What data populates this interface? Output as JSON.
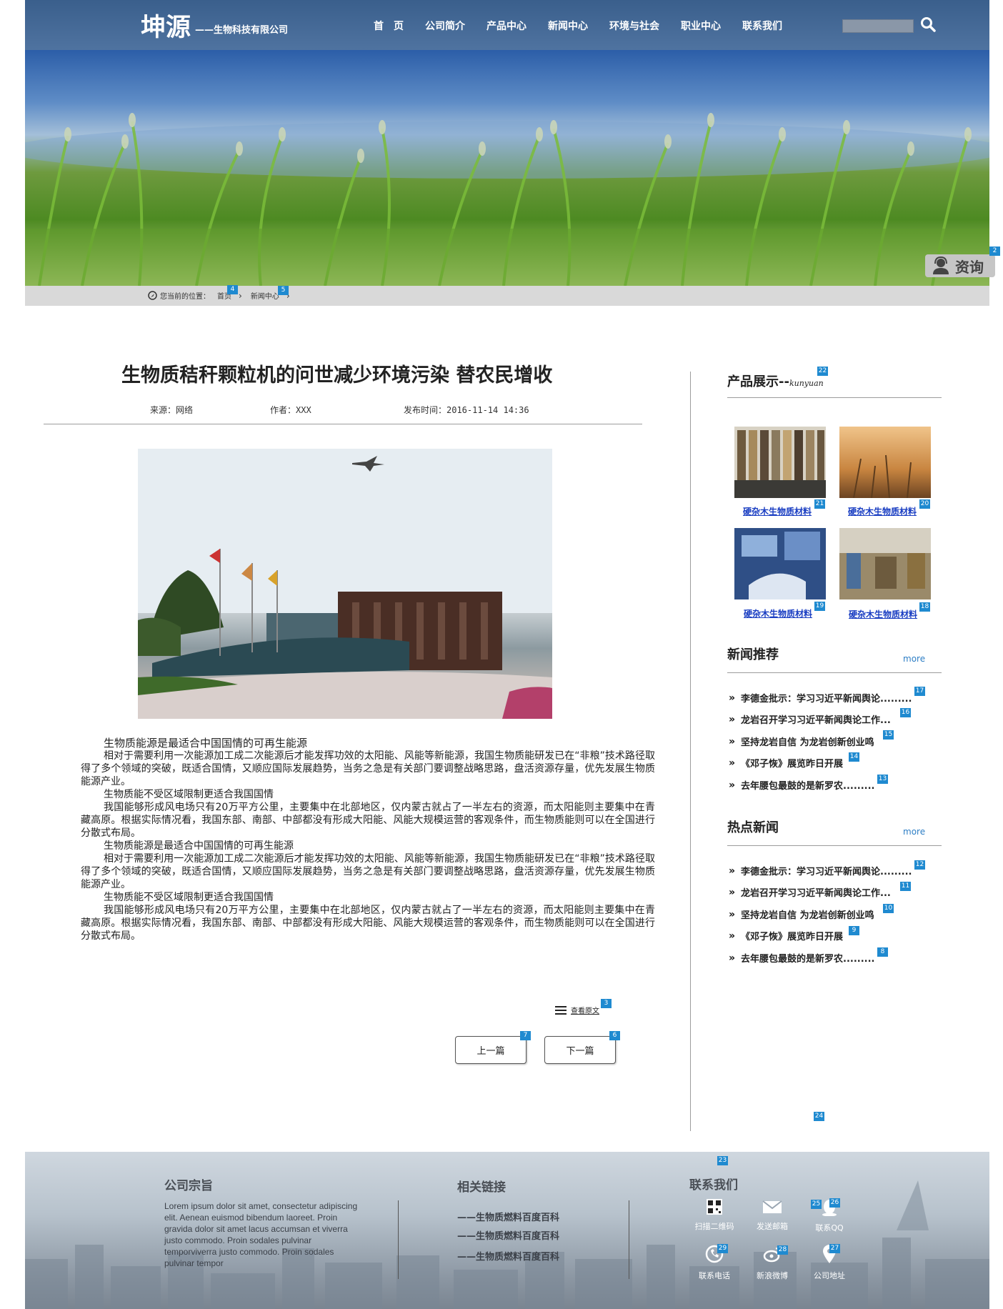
{
  "header": {
    "logo_main": "坤源",
    "logo_sub": "——生物科技有限公司",
    "nav": [
      "首　页",
      "公司简介",
      "产品中心",
      "新闻中心",
      "环境与社会",
      "职业中心",
      "联系我们"
    ]
  },
  "consult": {
    "label": "资询"
  },
  "breadcrumb": {
    "prefix": "您当前的位置：",
    "home": "首页",
    "current": "新闻中心"
  },
  "article": {
    "title": "生物质秸秆颗粒机的问世减少环境污染 替农民增收",
    "source": "来源：网络",
    "author": "作者：XXX",
    "published": "发布时间：2016-11-14 14:36",
    "paragraphs": [
      "生物质能源是最适合中国国情的可再生能源",
      "相对于需要利用一次能源加工成二次能源后才能发挥功效的太阳能、风能等新能源，我国生物质能研发已在“非粮”技术路径取得了多个领域的突破，既适合国情，又顺应国际发展趋势，当务之急是有关部门要调整战略思路，盘活资源存量，优先发展生物质能源产业。",
      "生物质能不受区域限制更适合我国国情",
      "我国能够形成风电场只有20万平方公里，主要集中在北部地区，仅内蒙古就占了一半左右的资源，而太阳能则主要集中在青藏高原。根据实际情况看，我国东部、南部、中部都没有形成大阳能、风能大规模运营的客观条件，而生物质能则可以在全国进行分散式布局。",
      "生物质能源是最适合中国国情的可再生能源",
      "相对于需要利用一次能源加工成二次能源后才能发挥功效的太阳能、风能等新能源，我国生物质能研发已在“非粮”技术路径取得了多个领域的突破，既适合国情，又顺应国际发展趋势，当务之急是有关部门要调整战略思路，盘活资源存量，优先发展生物质能源产业。",
      "生物质能不受区域限制更适合我国国情",
      "我国能够形成风电场只有20万平方公里，主要集中在北部地区，仅内蒙古就占了一半左右的资源，而太阳能则主要集中在青藏高原。根据实际情况看，我国东部、南部、中部都没有形成大阳能、风能大规模运营的客观条件，而生物质能则可以在全国进行分散式布局。"
    ],
    "view_original": "查看原文",
    "prev": "上一篇",
    "next": "下一篇"
  },
  "sidebar": {
    "products_title": "产品展示--",
    "products_sub": "kunyuan",
    "products": [
      "硬杂木生物质材料",
      "硬杂木生物质材料",
      "硬杂木生物质材料",
      "硬杂木生物质材料"
    ],
    "news_title": "新闻推荐",
    "hot_title": "热点新闻",
    "more": "more",
    "news": [
      "李德金批示：学习习近平新闻舆论.........",
      "龙岩召开学习习近平新闻舆论工作...",
      "坚持龙岩自信 为龙岩创新创业鸣",
      "《邓子恢》展览昨日开展",
      "去年腰包最鼓的是新罗农........."
    ],
    "hot": [
      "李德金批示：学习习近平新闻舆论.........",
      "龙岩召开学习习近平新闻舆论工作...",
      "坚持龙岩自信 为龙岩创新创业鸣",
      "《邓子恢》展览昨日开展",
      "去年腰包最鼓的是新罗农........."
    ]
  },
  "footer": {
    "purpose_title": "公司宗旨",
    "purpose_text": "Lorem ipsum dolor sit amet, consectetur adipiscing elit. Aenean euismod bibendum laoreet. Proin gravida dolor sit amet lacus accumsan et viverra justo commodo. Proin sodales pulvinar temporviverra justo commodo. Proin sodales pulvinar tempor",
    "links_title": "相关链接",
    "links": [
      "——生物质燃料百度百科",
      "——生物质燃料百度百科",
      "——生物质燃料百度百科"
    ],
    "contact_title": "联系我们",
    "contacts": [
      "扫描二维码",
      "发送邮箱",
      "联系QQ",
      "联系电话",
      "新浪微博",
      "公司地址"
    ]
  },
  "badges": [
    "2",
    "3",
    "4",
    "5",
    "6",
    "7",
    "8",
    "9",
    "10",
    "11",
    "12",
    "13",
    "14",
    "15",
    "16",
    "17",
    "18",
    "19",
    "20",
    "21",
    "22",
    "23",
    "24",
    "25",
    "26",
    "27",
    "28",
    "29"
  ]
}
